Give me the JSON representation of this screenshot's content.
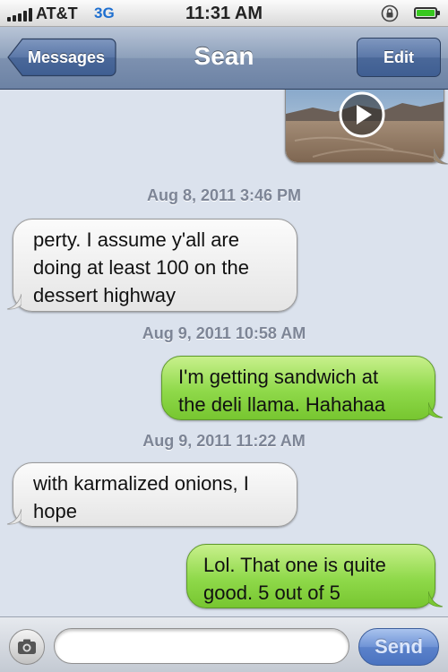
{
  "status": {
    "carrier": "AT&T",
    "network": "3G",
    "time": "11:31 AM",
    "battery_level": 1.0
  },
  "nav": {
    "back_label": "Messages",
    "title": "Sean",
    "edit_label": "Edit"
  },
  "thread": {
    "video_icon": "play-icon",
    "timestamps": [
      "Aug 8, 2011 3:46 PM",
      "Aug 9, 2011 10:58 AM",
      "Aug 9, 2011 11:22 AM"
    ],
    "messages": [
      {
        "direction": "in",
        "lines": [
          "perty. I assume y'all are",
          "doing at least 100 on the",
          "dessert highway"
        ]
      },
      {
        "direction": "out",
        "lines": [
          "I'm getting sandwich at",
          "the deli llama. Hahahaa"
        ]
      },
      {
        "direction": "in",
        "lines": [
          "with karmalized onions, I",
          "hope"
        ]
      },
      {
        "direction": "out",
        "lines": [
          "Lol. That one is quite",
          "good. 5 out of 5"
        ]
      }
    ]
  },
  "input": {
    "camera_icon": "camera-icon",
    "text_value": "",
    "send_label": "Send"
  },
  "colors": {
    "incoming_bubble": "#eeeeee",
    "outgoing_bubble": "#8fd94a",
    "background": "#dbe2ed",
    "nav": "#7d91b0"
  }
}
